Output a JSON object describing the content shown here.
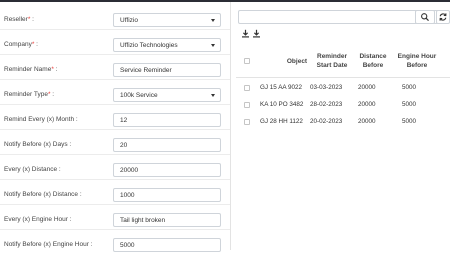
{
  "form": {
    "reseller": {
      "label": "Reseller",
      "required_mark": "*",
      "value": "Uffizio"
    },
    "company": {
      "label": "Company",
      "required_mark": "*",
      "value": "Uffizio Technologies"
    },
    "reminder_name": {
      "label": "Reminder Name",
      "required_mark": "*",
      "label_suffix": " :",
      "value": "Service Reminder"
    },
    "reminder_type": {
      "label": "Reminder Type",
      "required_mark": "*",
      "value": "100k Service"
    },
    "remind_every_month": {
      "label": "Remind Every (x) Month :",
      "value": "12"
    },
    "notify_before_days": {
      "label": "Notify Before (x) Days :",
      "value": "20"
    },
    "every_distance": {
      "label": "Every (x) Distance :",
      "value": "20000"
    },
    "notify_before_distance": {
      "label": "Notify Before (x) Distance :",
      "value": "1000"
    },
    "every_engine_hour": {
      "label": "Every (x) Engine Hour :",
      "value": "Tail light broken"
    },
    "notify_before_engine_hour": {
      "label": "Notify Before (x) Engine Hour :",
      "value": "5000"
    }
  },
  "search": {
    "value": "",
    "search_icon": "search-icon",
    "refresh_icon": "refresh-icon"
  },
  "export_icons": [
    "download-icon",
    "download-icon"
  ],
  "table": {
    "columns": {
      "object": "Object",
      "reminder_start_date": [
        "Reminder",
        "Start Date"
      ],
      "distance_before": [
        "Distance",
        "Before"
      ],
      "engine_hour_before": [
        "Engine Hour",
        "Before"
      ]
    },
    "rows": [
      {
        "object": "GJ 15 AA 9022",
        "reminder_start_date": "03-03-2023",
        "distance_before": "20000",
        "engine_hour_before": "5000"
      },
      {
        "object": "KA 10 PO 3482",
        "reminder_start_date": "28-02-2023",
        "distance_before": "20000",
        "engine_hour_before": "5000"
      },
      {
        "object": "GJ 28 HH 1122",
        "reminder_start_date": "20-02-2023",
        "distance_before": "20000",
        "engine_hour_before": "5000"
      }
    ]
  },
  "colors": {
    "topbar": "#2b2d35",
    "required": "#e53935",
    "border": "#cfd4da"
  }
}
